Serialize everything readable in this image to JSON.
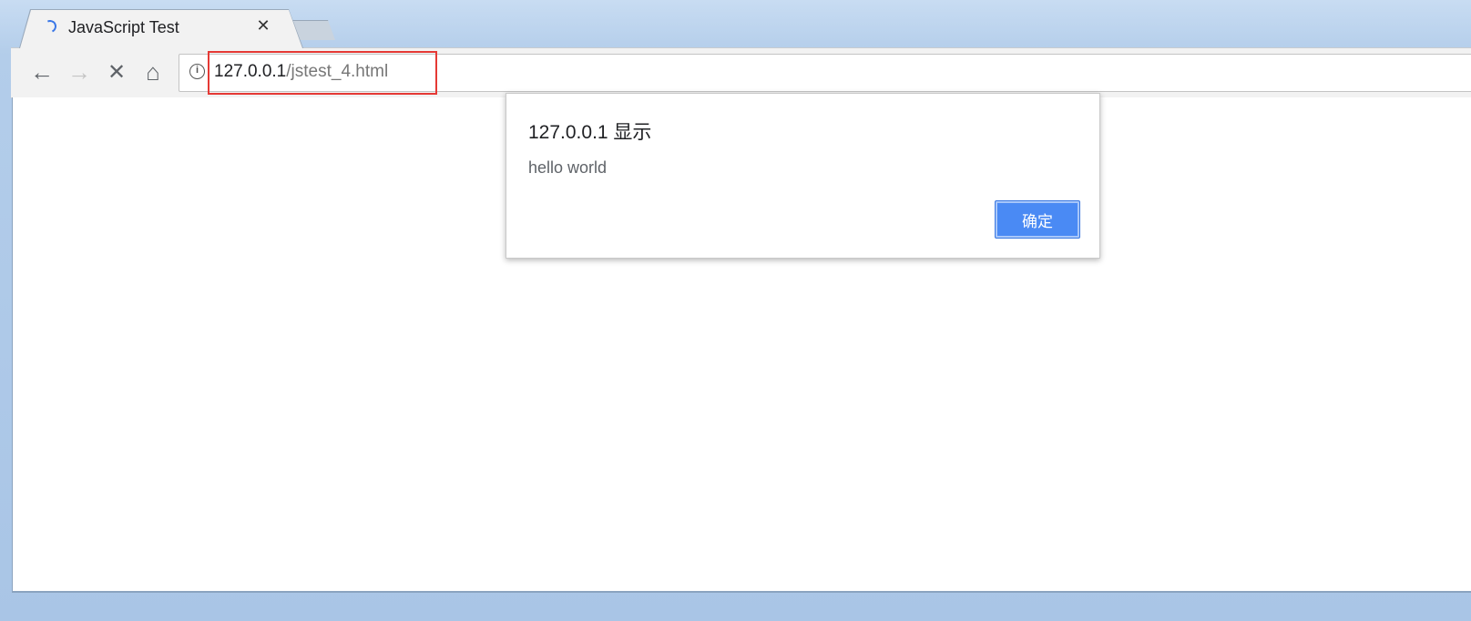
{
  "browser": {
    "tab": {
      "title": "JavaScript Test",
      "close_glyph": "✕"
    },
    "nav": {
      "back_glyph": "←",
      "forward_glyph": "→",
      "stop_glyph": "✕",
      "home_glyph": "⌂"
    },
    "omnibox": {
      "info_glyph": "i",
      "url_host": "127.0.0.1",
      "url_path": "/jstest_4.html"
    }
  },
  "dialog": {
    "title": "127.0.0.1 显示",
    "message": "hello world",
    "ok_label": "确定"
  },
  "colors": {
    "accent": "#4a8af4",
    "highlight": "#e53935",
    "spinner": "#3b78e7"
  },
  "icons": [
    "loading-spinner-icon",
    "close-icon",
    "back-arrow-icon",
    "forward-arrow-icon",
    "stop-icon",
    "home-icon",
    "info-icon"
  ]
}
